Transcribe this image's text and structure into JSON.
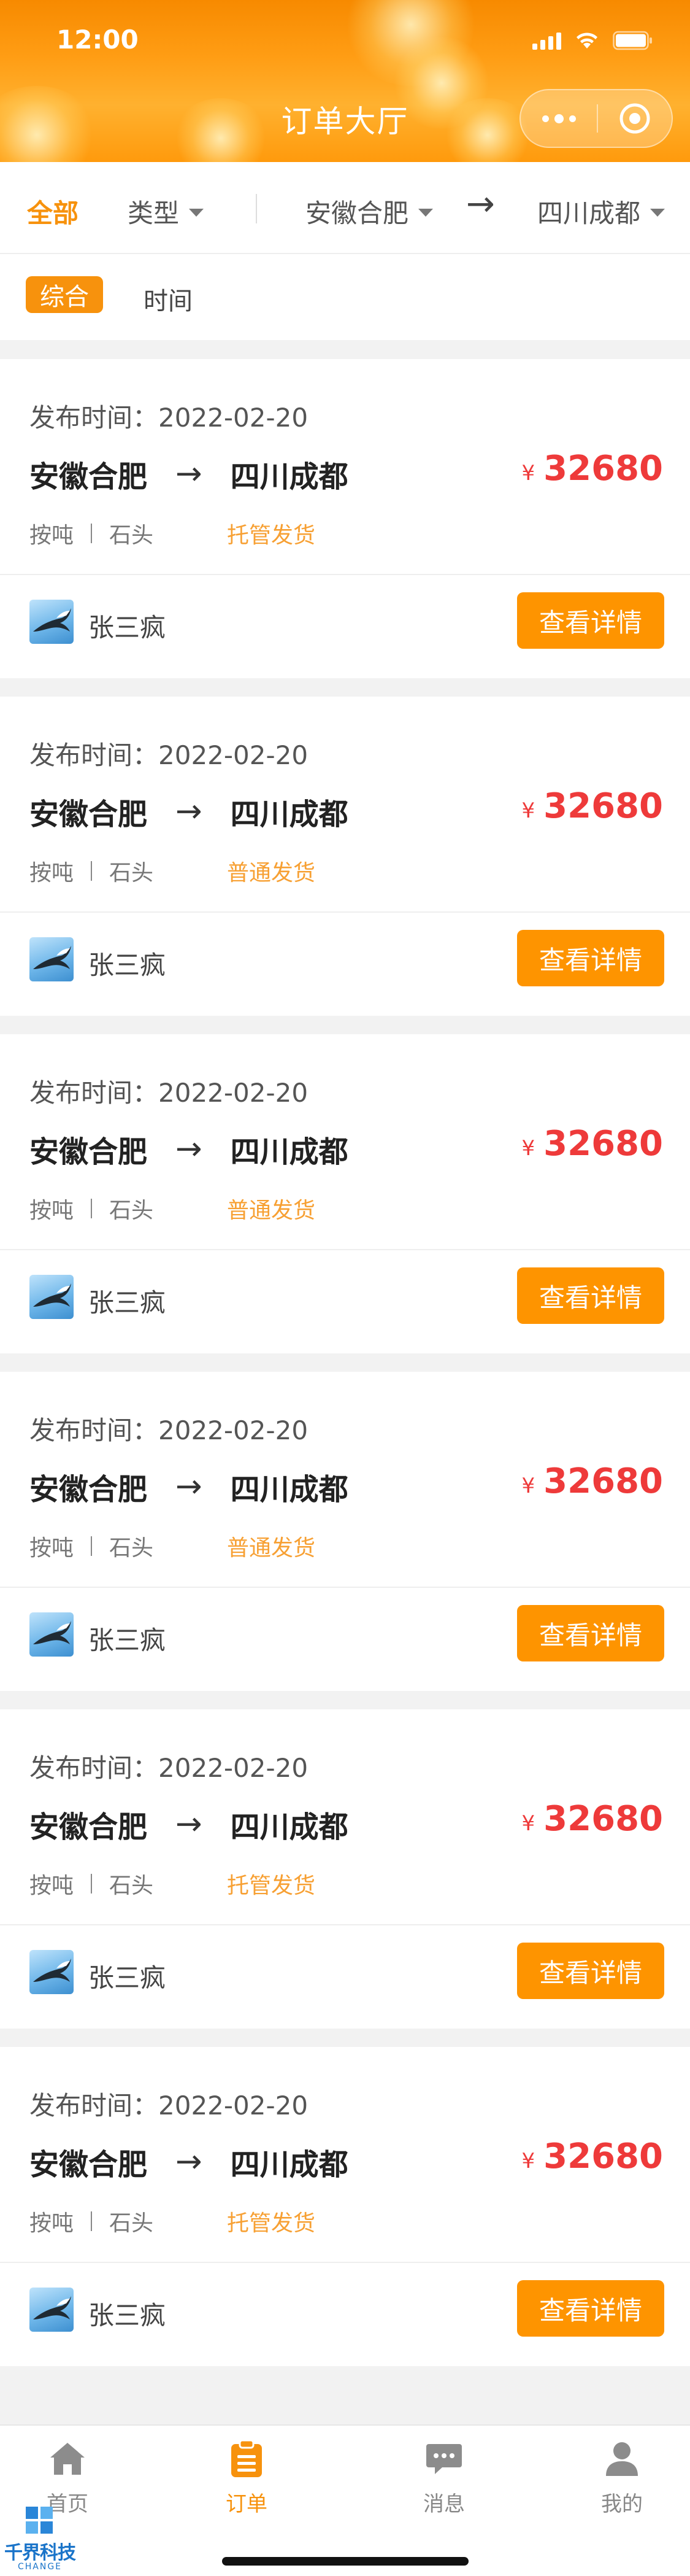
{
  "status_bar": {
    "time": "12:00"
  },
  "nav": {
    "title": "订单大厅"
  },
  "filters": {
    "all_label": "全部",
    "type_label": "类型",
    "from_label": "安徽合肥",
    "arrow": "→",
    "to_label": "四川成都"
  },
  "sort": {
    "active_label": "综合",
    "time_label": "时间"
  },
  "orders": [
    {
      "time_label": "发布时间：",
      "date": "2022-02-20",
      "from": "安徽合肥",
      "arrow": "→",
      "to": "四川成都",
      "currency": "¥",
      "price": "32680",
      "unit": "按吨",
      "cargo": "石头",
      "ship_type": "托管发货",
      "user": "张三疯",
      "button": "查看详情"
    },
    {
      "time_label": "发布时间：",
      "date": "2022-02-20",
      "from": "安徽合肥",
      "arrow": "→",
      "to": "四川成都",
      "currency": "¥",
      "price": "32680",
      "unit": "按吨",
      "cargo": "石头",
      "ship_type": "普通发货",
      "user": "张三疯",
      "button": "查看详情"
    },
    {
      "time_label": "发布时间：",
      "date": "2022-02-20",
      "from": "安徽合肥",
      "arrow": "→",
      "to": "四川成都",
      "currency": "¥",
      "price": "32680",
      "unit": "按吨",
      "cargo": "石头",
      "ship_type": "普通发货",
      "user": "张三疯",
      "button": "查看详情"
    },
    {
      "time_label": "发布时间：",
      "date": "2022-02-20",
      "from": "安徽合肥",
      "arrow": "→",
      "to": "四川成都",
      "currency": "¥",
      "price": "32680",
      "unit": "按吨",
      "cargo": "石头",
      "ship_type": "普通发货",
      "user": "张三疯",
      "button": "查看详情"
    },
    {
      "time_label": "发布时间：",
      "date": "2022-02-20",
      "from": "安徽合肥",
      "arrow": "→",
      "to": "四川成都",
      "currency": "¥",
      "price": "32680",
      "unit": "按吨",
      "cargo": "石头",
      "ship_type": "托管发货",
      "user": "张三疯",
      "button": "查看详情"
    },
    {
      "time_label": "发布时间：",
      "date": "2022-02-20",
      "from": "安徽合肥",
      "arrow": "→",
      "to": "四川成都",
      "currency": "¥",
      "price": "32680",
      "unit": "按吨",
      "cargo": "石头",
      "ship_type": "托管发货",
      "user": "张三疯",
      "button": "查看详情"
    }
  ],
  "tabs": [
    {
      "label": "首页",
      "icon": "home-icon",
      "active": false
    },
    {
      "label": "订单",
      "icon": "order-icon",
      "active": true
    },
    {
      "label": "消息",
      "icon": "message-icon",
      "active": false
    },
    {
      "label": "我的",
      "icon": "user-icon",
      "active": false
    }
  ],
  "watermark": {
    "text": "千界科技",
    "sub": "CHANGE"
  },
  "colors": {
    "accent": "#f7920d",
    "button": "#fe9400",
    "price": "#ee3a3a",
    "ship_type": "#f7a033"
  }
}
